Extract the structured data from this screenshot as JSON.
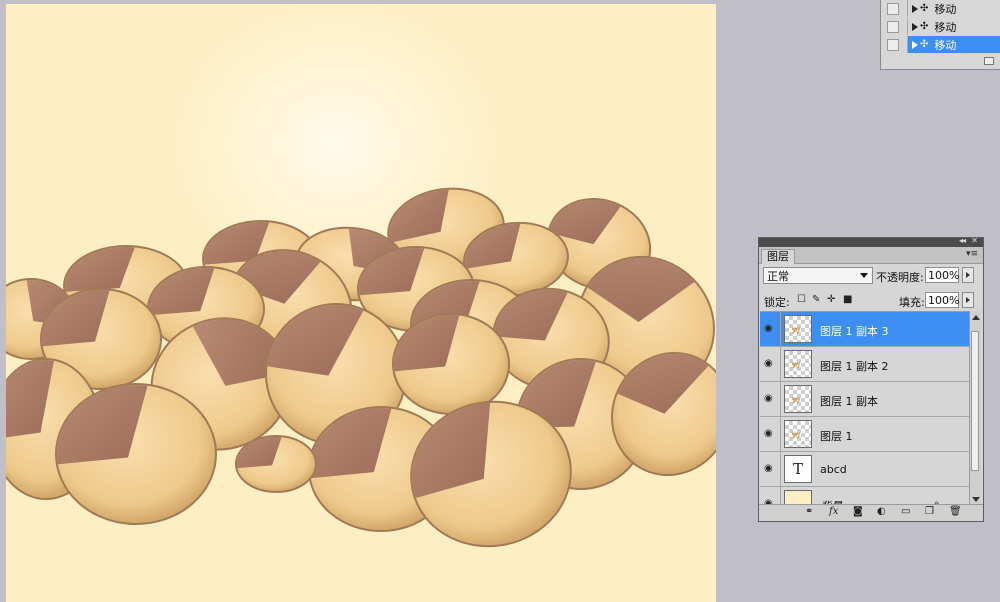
{
  "actions_panel": {
    "rows": [
      {
        "label": "移动",
        "selected": false
      },
      {
        "label": "移动",
        "selected": false
      },
      {
        "label": "移动",
        "selected": true
      }
    ]
  },
  "layers_panel": {
    "tab": "图层",
    "blend_mode": "正常",
    "opacity_label": "不透明度:",
    "opacity_value": "100%",
    "lock_label": "锁定:",
    "fill_label": "填充:",
    "fill_value": "100%",
    "layers": [
      {
        "name": "图层 1 副本 3",
        "kind": "pixel",
        "selected": true
      },
      {
        "name": "图层 1 副本 2",
        "kind": "pixel",
        "selected": false
      },
      {
        "name": "图层 1 副本",
        "kind": "pixel",
        "selected": false
      },
      {
        "name": "图层 1",
        "kind": "pixel",
        "selected": false
      },
      {
        "name": "abcd",
        "kind": "text",
        "selected": false
      },
      {
        "name": "背景",
        "kind": "background",
        "selected": false
      }
    ],
    "text_thumb_glyph": "T",
    "footer_icons": [
      "link-icon",
      "fx-icon",
      "mask-icon",
      "adjustment-icon",
      "group-icon",
      "new-layer-icon",
      "trash-icon"
    ]
  },
  "colors": {
    "selection": "#3d8ef0",
    "canvas_bg": "#feeec4",
    "workspace": "#c0bec6"
  }
}
